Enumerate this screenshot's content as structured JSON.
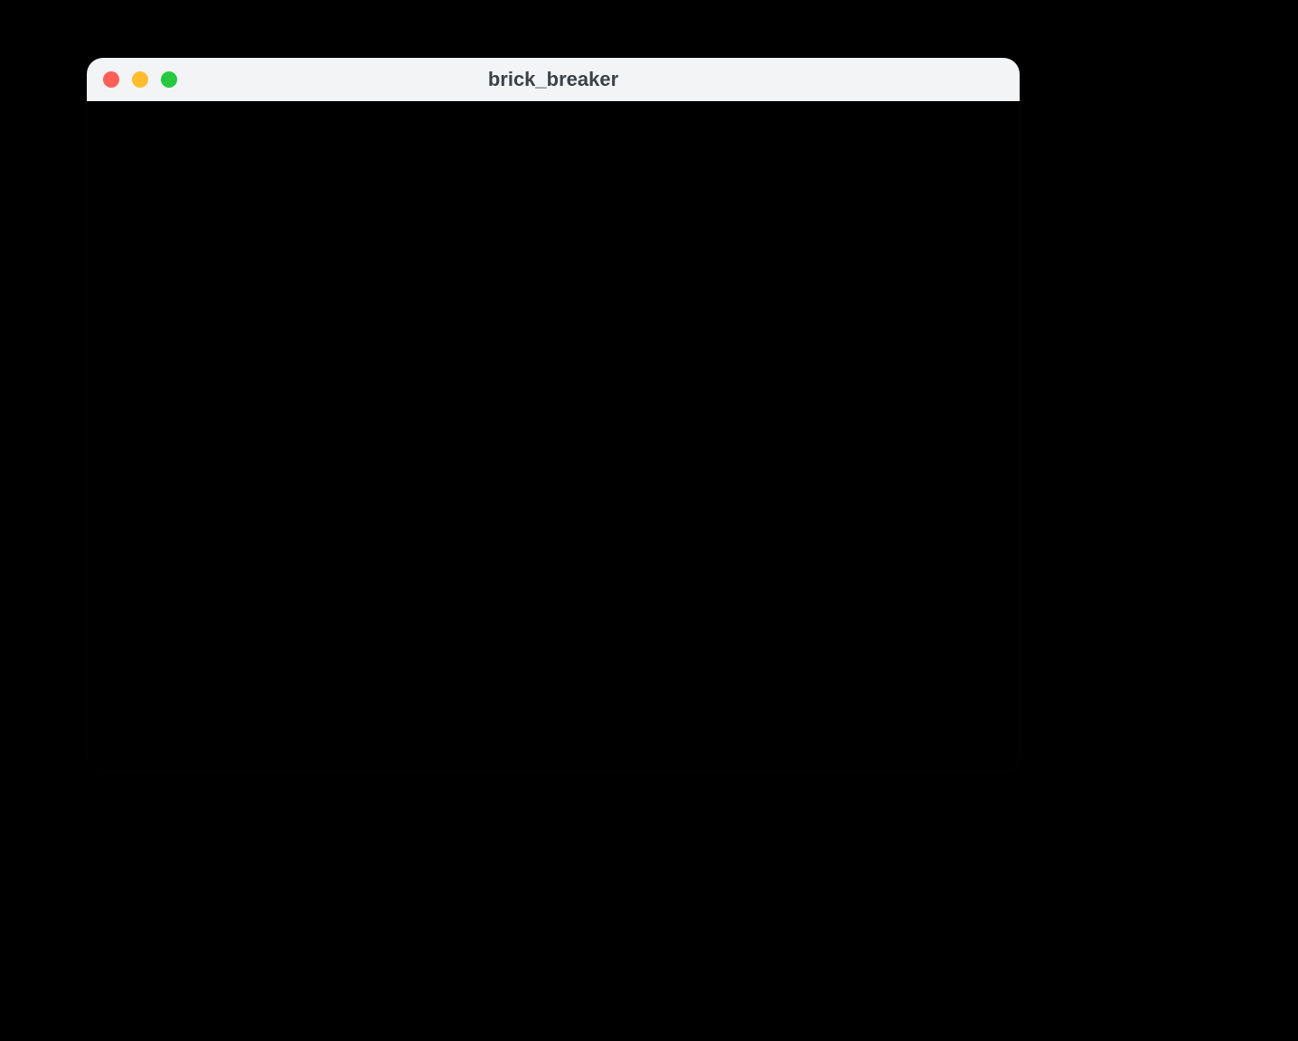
{
  "window": {
    "title": "brick_breaker"
  },
  "traffic_lights": {
    "close_color": "#ff5f57",
    "minimize_color": "#febc2e",
    "zoom_color": "#28c840"
  }
}
